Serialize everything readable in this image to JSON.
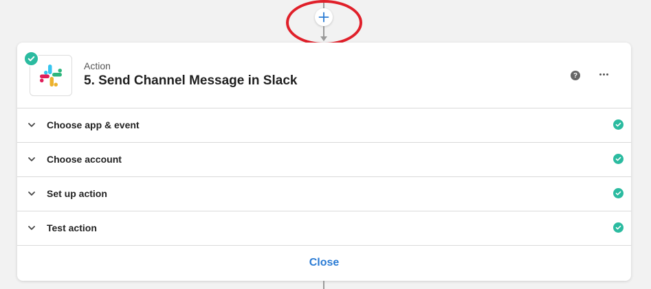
{
  "step": {
    "kind": "Action",
    "title": "5. Send Channel Message in Slack",
    "app_icon": "slack-logo",
    "help_label": "?",
    "status": "complete"
  },
  "sections": [
    {
      "label": "Choose app & event",
      "status": "complete"
    },
    {
      "label": "Choose account",
      "status": "complete"
    },
    {
      "label": "Set up action",
      "status": "complete"
    },
    {
      "label": "Test action",
      "status": "complete"
    }
  ],
  "footer": {
    "close_label": "Close"
  },
  "colors": {
    "accent": "#2a7bd4",
    "success": "#2bbba0",
    "highlight": "#e0202a"
  },
  "icons": {
    "add_step": "plus-icon",
    "more": "ellipsis-icon",
    "help": "question-icon",
    "expand": "chevron-down-icon",
    "done": "check-icon"
  }
}
